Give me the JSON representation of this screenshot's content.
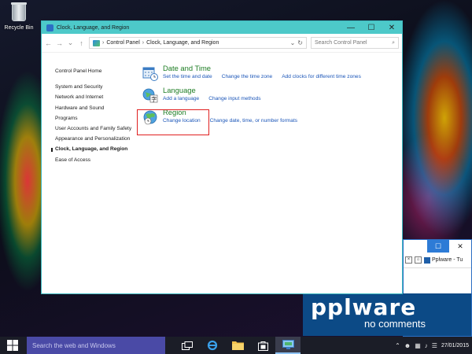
{
  "desktop": {
    "recycle_bin_label": "Recycle Bin"
  },
  "background_window": {
    "tab_title": "Pplware - Tu",
    "banner_logo": "pplware",
    "banner_tagline": "no comments",
    "maximize_glyph": "☐",
    "close_glyph": "✕"
  },
  "window": {
    "title": "Clock, Language, and Region",
    "minimize_glyph": "—",
    "maximize_glyph": "☐",
    "close_glyph": "✕"
  },
  "address": {
    "back_glyph": "←",
    "forward_glyph": "→",
    "dropdown_glyph": "⌄",
    "up_glyph": "↑",
    "breadcrumb": [
      "Control Panel",
      "Clock, Language, and Region"
    ],
    "separator": "›",
    "search_placeholder": "Search Control Panel",
    "search_glyph": "⌕"
  },
  "left_nav": {
    "home": "Control Panel Home",
    "items": [
      "System and Security",
      "Network and Internet",
      "Hardware and Sound",
      "Programs",
      "User Accounts and Family Safety",
      "Appearance and Personalization",
      "Clock, Language, and Region",
      "Ease of Access"
    ]
  },
  "categories": [
    {
      "title": "Date and Time",
      "icon": "clock-calendar-icon",
      "links": [
        "Set the time and date",
        "Change the time zone",
        "Add clocks for different time zones"
      ]
    },
    {
      "title": "Language",
      "icon": "language-icon",
      "links": [
        "Add a language",
        "Change input methods"
      ]
    },
    {
      "title": "Region",
      "icon": "globe-clock-icon",
      "links": [
        "Change location",
        "Change date, time, or number formats"
      ]
    }
  ],
  "taskbar": {
    "search_placeholder": "Search the web and Windows",
    "date": "27/01/2015"
  },
  "colors": {
    "titlebar": "#4dc9c9",
    "category_title": "#1e7d24",
    "link": "#1a55b8",
    "highlight": "#e02020",
    "taskbar_search": "#4a4aa6"
  }
}
